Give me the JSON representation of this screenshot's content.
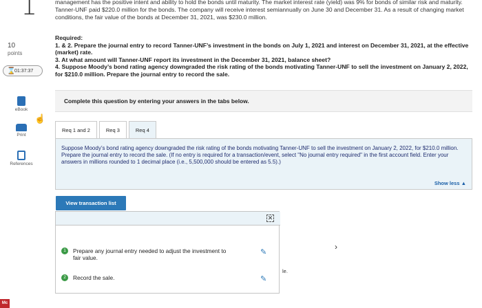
{
  "sidebar": {
    "question_number": "1",
    "points_value": "10",
    "points_label": "points",
    "timer": "01:37:37",
    "items": [
      {
        "label": "eBook",
        "icon": "ebook-icon"
      },
      {
        "label": "Print",
        "icon": "print-icon"
      },
      {
        "label": "References",
        "icon": "references-icon"
      }
    ],
    "brand_badge": "Mc"
  },
  "problem": {
    "intro": "management has the positive intent and ability to hold the bonds until maturity. The market interest rate (yield) was 9% for bonds of similar risk and maturity. Tanner-UNF paid $220.0 million for the bonds. The company will receive interest semiannually on June 30 and December 31. As a result of changing market conditions, the fair value of the bonds at December 31, 2021, was $230.0 million.",
    "required_title": "Required:",
    "req_1_2": "1. & 2. Prepare the journal entry to record Tanner-UNF’s investment in the bonds on July 1, 2021 and interest on December 31, 2021, at the effective (market) rate.",
    "req_3": "3. At what amount will Tanner-UNF report its investment in the December 31, 2021, balance sheet?",
    "req_4": "4. Suppose Moody’s bond rating agency downgraded the risk rating of the bonds motivating Tanner-UNF to sell the investment on January 2, 2022, for $210.0 million. Prepare the journal entry to record the sale."
  },
  "instructions": {
    "complete_text": "Complete this question by entering your answers in the tabs below."
  },
  "tabs": [
    {
      "label": "Req 1 and 2"
    },
    {
      "label": "Req 3"
    },
    {
      "label": "Req 4"
    }
  ],
  "tab_panel": {
    "description": "Suppose Moody’s bond rating agency downgraded the risk rating of the bonds motivating Tanner-UNF to sell the investment on January 2, 2022, for $210.0 million. Prepare the journal entry to record the sale. (If no entry is required for a transaction/event, select \"No journal entry required\" in the first account field. Enter your answers in millions rounded to 1 decimal place (i.e., 5,500,000 should be entered as 5.5).)",
    "show_less": "Show less ▲"
  },
  "transaction_list": {
    "button_label": "View transaction list",
    "close_glyph": "✕",
    "steps": [
      {
        "number": "1",
        "text": "Prepare any journal entry needed to adjust the investment to fair value."
      },
      {
        "number": "2",
        "text": "Record the sale."
      }
    ]
  },
  "fragments": {
    "chevron": "›",
    "partial_text": "le."
  }
}
